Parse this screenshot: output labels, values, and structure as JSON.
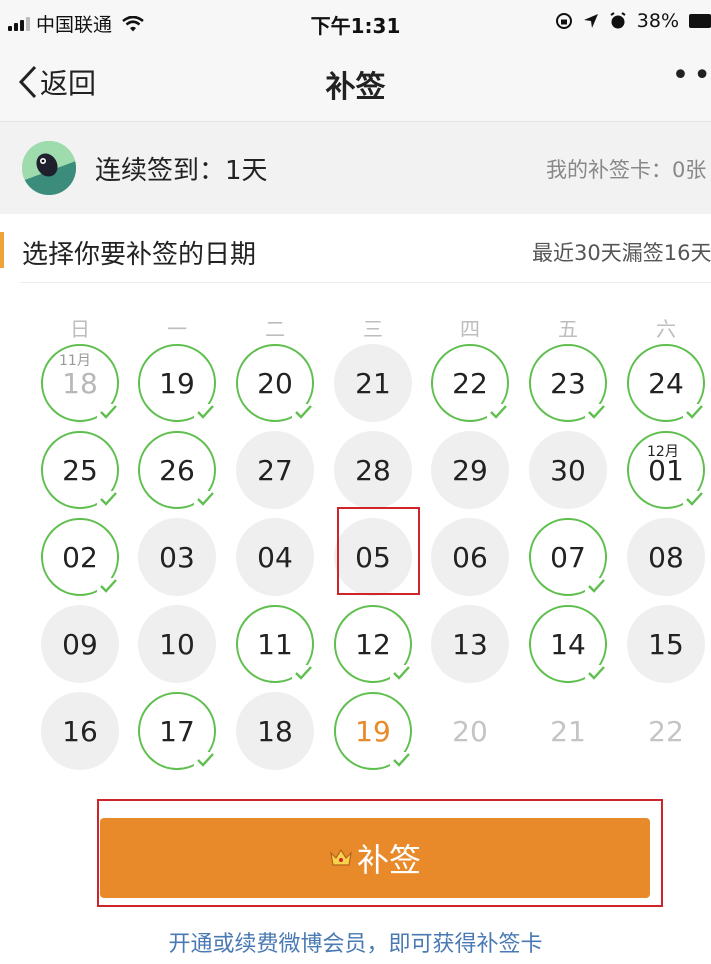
{
  "status": {
    "carrier": "中国联通",
    "time": "下午1:31",
    "battery": "38%"
  },
  "nav": {
    "back_label": "返回",
    "title": "补签"
  },
  "streak": {
    "label": "连续签到：1天",
    "cards": "我的补签卡：0张"
  },
  "select": {
    "label": "选择你要补签的日期",
    "missed": "最近30天漏签16天"
  },
  "calendar": {
    "weekdays": [
      "日",
      "一",
      "二",
      "三",
      "四",
      "五",
      "六"
    ],
    "month_tags": [
      "11月",
      "12月"
    ],
    "days": [
      {
        "label": "18",
        "state": "signed-faded"
      },
      {
        "label": "19",
        "state": "signed"
      },
      {
        "label": "20",
        "state": "signed"
      },
      {
        "label": "21",
        "state": "plain"
      },
      {
        "label": "22",
        "state": "signed"
      },
      {
        "label": "23",
        "state": "signed"
      },
      {
        "label": "24",
        "state": "signed"
      },
      {
        "label": "25",
        "state": "signed"
      },
      {
        "label": "26",
        "state": "signed"
      },
      {
        "label": "27",
        "state": "plain"
      },
      {
        "label": "28",
        "state": "plain"
      },
      {
        "label": "29",
        "state": "plain"
      },
      {
        "label": "30",
        "state": "plain"
      },
      {
        "label": "01",
        "state": "signed"
      },
      {
        "label": "02",
        "state": "signed"
      },
      {
        "label": "03",
        "state": "plain"
      },
      {
        "label": "04",
        "state": "plain"
      },
      {
        "label": "05",
        "state": "plain"
      },
      {
        "label": "06",
        "state": "plain"
      },
      {
        "label": "07",
        "state": "signed"
      },
      {
        "label": "08",
        "state": "plain"
      },
      {
        "label": "09",
        "state": "plain"
      },
      {
        "label": "10",
        "state": "plain"
      },
      {
        "label": "11",
        "state": "signed"
      },
      {
        "label": "12",
        "state": "signed"
      },
      {
        "label": "13",
        "state": "plain"
      },
      {
        "label": "14",
        "state": "signed"
      },
      {
        "label": "15",
        "state": "plain"
      },
      {
        "label": "16",
        "state": "plain"
      },
      {
        "label": "17",
        "state": "signed"
      },
      {
        "label": "18",
        "state": "plain"
      },
      {
        "label": "19",
        "state": "today"
      },
      {
        "label": "20",
        "state": "future"
      },
      {
        "label": "21",
        "state": "future"
      },
      {
        "label": "22",
        "state": "future"
      }
    ]
  },
  "button": {
    "label": "补签",
    "icon": "crown-icon"
  },
  "footer": {
    "link": "开通或续费微博会员，即可获得补签卡"
  },
  "colors": {
    "accent": "#e8892a",
    "signed_ring": "#5fbf4e",
    "highlight": "#d0242b",
    "link": "#4a7ab3"
  }
}
